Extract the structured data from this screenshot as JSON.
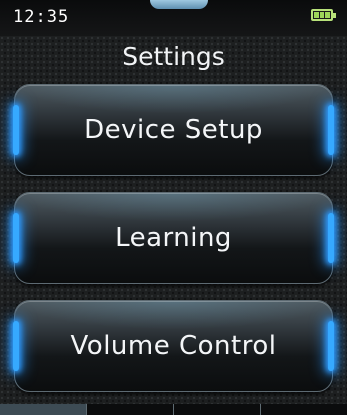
{
  "status_bar": {
    "time": "12:35",
    "battery_level": 1.0,
    "battery_color": "#9ed75a"
  },
  "page": {
    "title": "Settings"
  },
  "menu": [
    {
      "label": "Device Setup"
    },
    {
      "label": "Learning"
    },
    {
      "label": "Volume Control"
    }
  ],
  "colors": {
    "accent_glow": "#36a9ff",
    "text": "#f4f6f8"
  },
  "icons": {
    "battery": "battery-icon",
    "top_tab": "top-tab-indicator"
  }
}
